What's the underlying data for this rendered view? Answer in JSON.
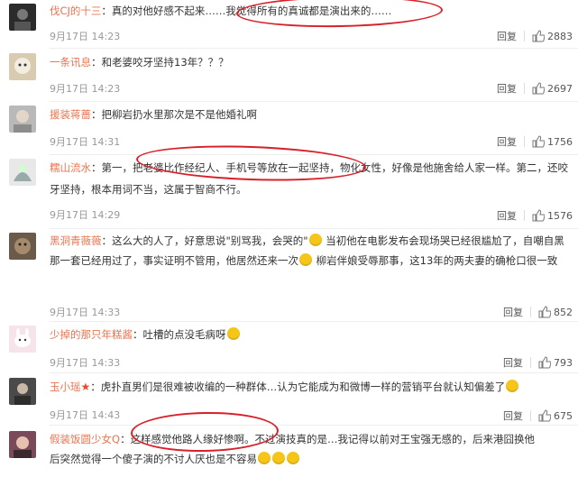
{
  "comments": [
    {
      "user": "伐CJ的十三",
      "content": "：真的对他好感不起来……我觉得所有的真诚都是演出来的……",
      "time": "9月17日 14:23",
      "reply": "回复",
      "likes": "2883"
    },
    {
      "user": "一条讯息",
      "content": "：和老婆咬牙坚持13年？？？",
      "time": "9月17日 14:23",
      "reply": "回复",
      "likes": "2697"
    },
    {
      "user": "援装蒋蔷",
      "content": "：把柳岩扔水里那次是不是他婚礼啊",
      "time": "9月17日 14:31",
      "reply": "回复",
      "likes": "1756"
    },
    {
      "user": "糯山流水",
      "content": "：第一，把老婆比作经纪人、手机号等放在一起坚持，物化女性，好像是他施舍给人家一样。第二，还咬牙坚持，根本用词不当，这属于智商不行。",
      "time": "9月17日 14:29",
      "reply": "回复",
      "likes": "1576"
    },
    {
      "user": "黑洞青薇薇",
      "content_a": "：这么大的人了，好意思说\"别骂我，会哭的\"",
      "content_b": "当初他在电影发布会现场哭已经很尴尬了，自嘲自黑那一套已经用过了，事实证明不管用，他居然还来一次",
      "content_c": "柳岩伴娘受辱那事，这13年的两夫妻的确枪口很一致",
      "time": "9月17日 14:33",
      "reply": "回复",
      "likes": "852"
    },
    {
      "user": "少掉的那只年糕酱",
      "content": "：吐槽的点没毛病呀",
      "time": "9月17日 14:33",
      "reply": "回复",
      "likes": "793"
    },
    {
      "user": "玉小瑶",
      "content": "：虎扑直男们是很难被收编的一种群体…认为它能成为和微博一样的营销平台就认知偏差了",
      "time": "9月17日 14:43",
      "reply": "回复",
      "likes": "675"
    },
    {
      "user": "假装饭圆少女Q",
      "content_a": "：这样感觉他路人缘好惨啊。不过演技真的是…我记得以前对王宝强无感的，后来港囧换他",
      "content_b": "后突然觉得一个傻子演的不讨人厌也是不容易"
    }
  ],
  "colors": {
    "username": "#eb7350",
    "meta": "#999999",
    "annotation": "#d8202a"
  }
}
